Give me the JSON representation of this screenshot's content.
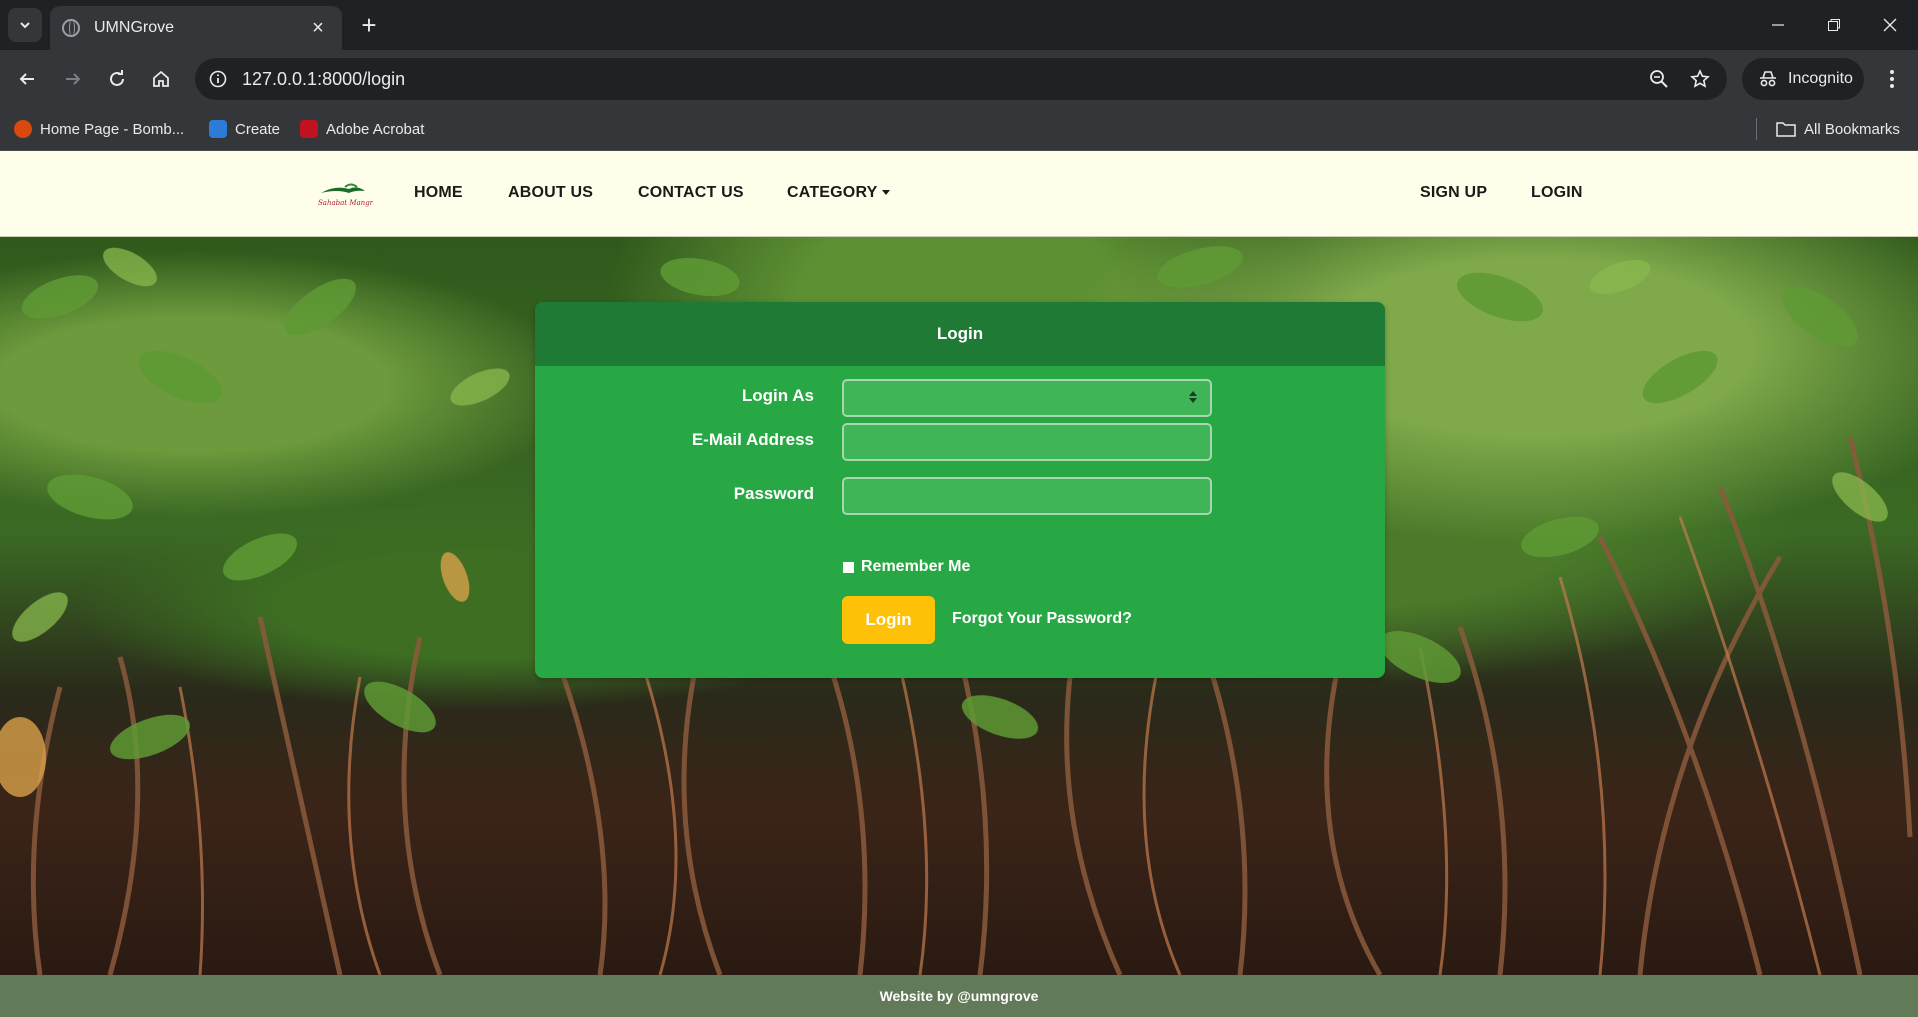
{
  "browser": {
    "tab_title": "UMNGrove",
    "url": "127.0.0.1:8000/login",
    "profile_label": "Incognito",
    "bookmarks": [
      {
        "label": "Home Page - Bomb...",
        "icon": "bombay-favicon",
        "color": "#d9480f"
      },
      {
        "label": "Create",
        "icon": "create-favicon",
        "color": "#2b7bd8"
      },
      {
        "label": "Adobe Acrobat",
        "icon": "acrobat-favicon",
        "color": "#c1121f"
      }
    ],
    "all_bookmarks_label": "All Bookmarks"
  },
  "navbar": {
    "logo_alt": "Sahabat Mangrove",
    "links": {
      "home": "HOME",
      "about": "ABOUT US",
      "contact": "CONTACT US",
      "category": "CATEGORY",
      "signup": "SIGN UP",
      "login": "LOGIN"
    }
  },
  "login_card": {
    "title": "Login",
    "login_as_label": "Login As",
    "login_as_value": "",
    "email_label": "E-Mail Address",
    "email_value": "",
    "password_label": "Password",
    "password_value": "",
    "remember_label": "Remember Me",
    "remember_checked": false,
    "submit_label": "Login",
    "forgot_label": "Forgot Your Password?"
  },
  "footer": {
    "text": "Website by @umngrove"
  },
  "colors": {
    "navbar_bg": "#fffeeb",
    "card_header": "#1e7a35",
    "card_body": "#28a745",
    "submit_button": "#ffc107",
    "footer_bg": "#637a58"
  }
}
